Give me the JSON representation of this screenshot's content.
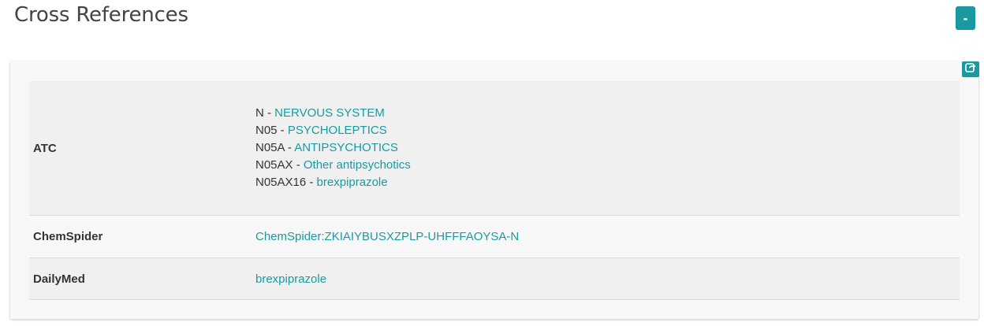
{
  "section": {
    "title": "Cross References",
    "collapse_label": "-"
  },
  "icons": {
    "share": "share-icon"
  },
  "colors": {
    "accent": "#1a9aa0",
    "text": "#333333"
  },
  "rows": {
    "atc": {
      "label": "ATC",
      "items": [
        {
          "code": "N - ",
          "name": "NERVOUS SYSTEM"
        },
        {
          "code": "N05 - ",
          "name": "PSYCHOLEPTICS"
        },
        {
          "code": "N05A - ",
          "name": "ANTIPSYCHOTICS"
        },
        {
          "code": "N05AX - ",
          "name": "Other antipsychotics"
        },
        {
          "code": "N05AX16 - ",
          "name": "brexpiprazole"
        }
      ]
    },
    "chemspider": {
      "label": "ChemSpider",
      "value": "ChemSpider:ZKIAIYBUSXZPLP-UHFFFAOYSA-N"
    },
    "dailymed": {
      "label": "DailyMed",
      "value": "brexpiprazole"
    }
  }
}
